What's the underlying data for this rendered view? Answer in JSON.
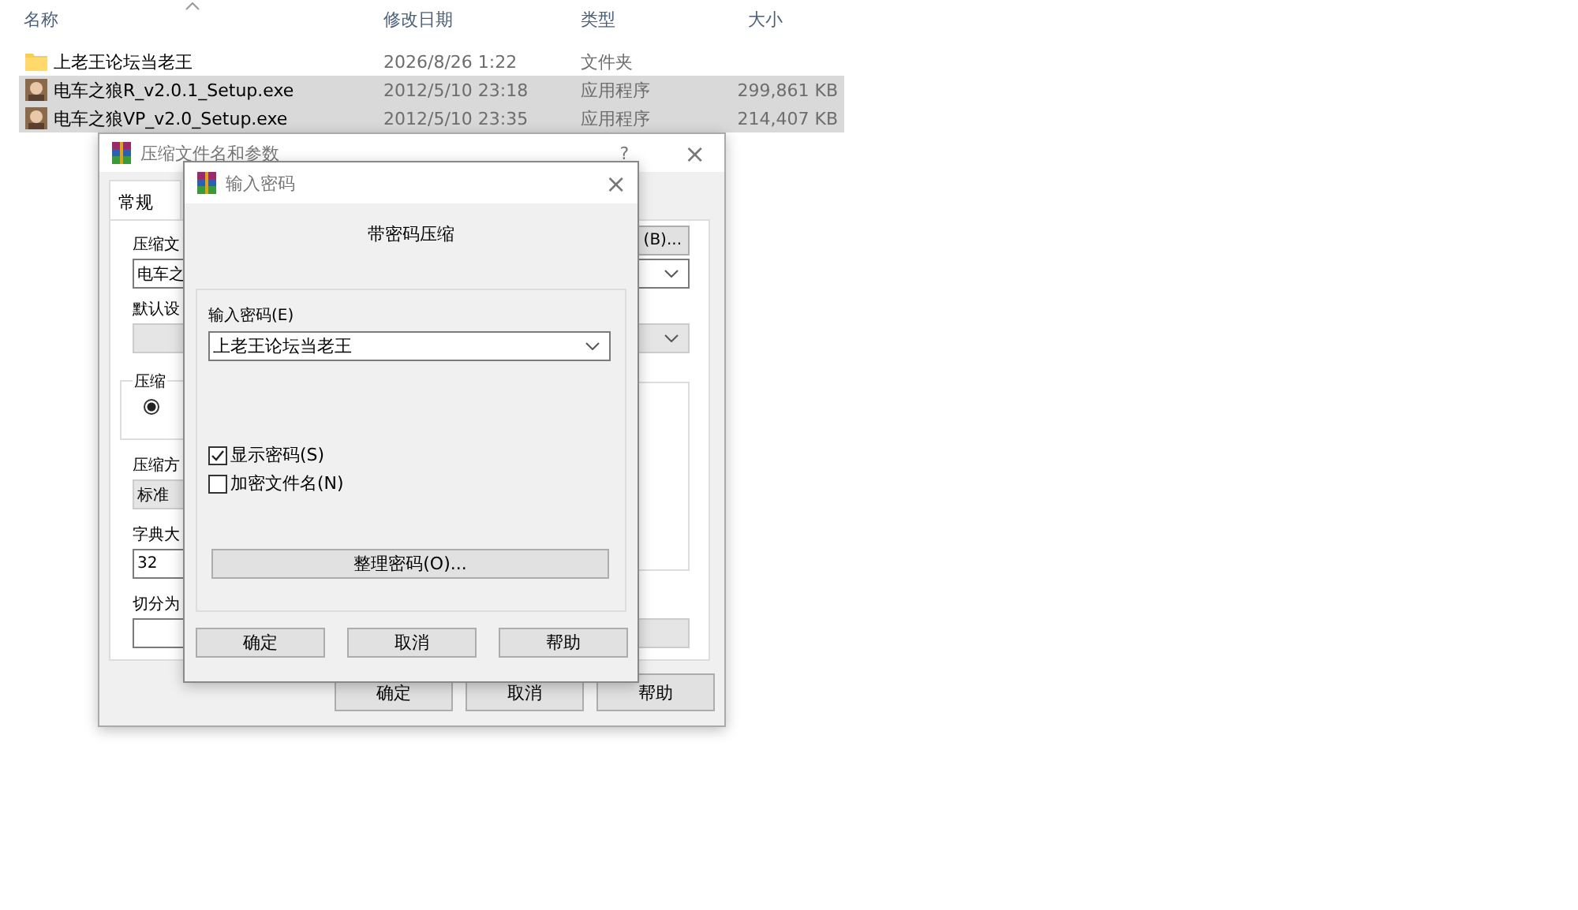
{
  "explorer": {
    "columns": [
      "名称",
      "修改日期",
      "类型",
      "大小"
    ],
    "rows": [
      {
        "kind": "folder",
        "name": "上老王论坛当老王",
        "date": "2026/8/26 1:22",
        "type": "文件夹",
        "size": "",
        "selected": false
      },
      {
        "kind": "app",
        "name": "电车之狼R_v2.0.1_Setup.exe",
        "date": "2012/5/10 23:18",
        "type": "应用程序",
        "size": "299,861 KB",
        "selected": true
      },
      {
        "kind": "app",
        "name": "电车之狼VP_v2.0_Setup.exe",
        "date": "2012/5/10 23:35",
        "type": "应用程序",
        "size": "214,407 KB",
        "selected": true
      }
    ]
  },
  "archive_dialog": {
    "title": "压缩文件名和参数",
    "help": "?",
    "close": "×",
    "tab": "常规",
    "archive_label": "压缩文",
    "browse_button": "(B)...",
    "archive_value": "电车之",
    "profile_label": "默认设",
    "group_label": "压缩",
    "radio": {
      "selected": true
    },
    "method_label": "压缩方",
    "method_value": "标准",
    "dict_label": "字典大",
    "dict_value": "32",
    "split_label": "切分为",
    "buttons": [
      "确定",
      "取消",
      "帮助"
    ]
  },
  "password_dialog": {
    "title": "输入密码",
    "close": "×",
    "heading": "带密码压缩",
    "password_label": "输入密码(E)",
    "password_value": "上老王论坛当老王",
    "options": [
      {
        "label": "显示密码(S)",
        "checked": true
      },
      {
        "label": "加密文件名(N)",
        "checked": false
      }
    ],
    "organize_button": "整理密码(O)...",
    "buttons": [
      "确定",
      "取消",
      "帮助"
    ]
  }
}
